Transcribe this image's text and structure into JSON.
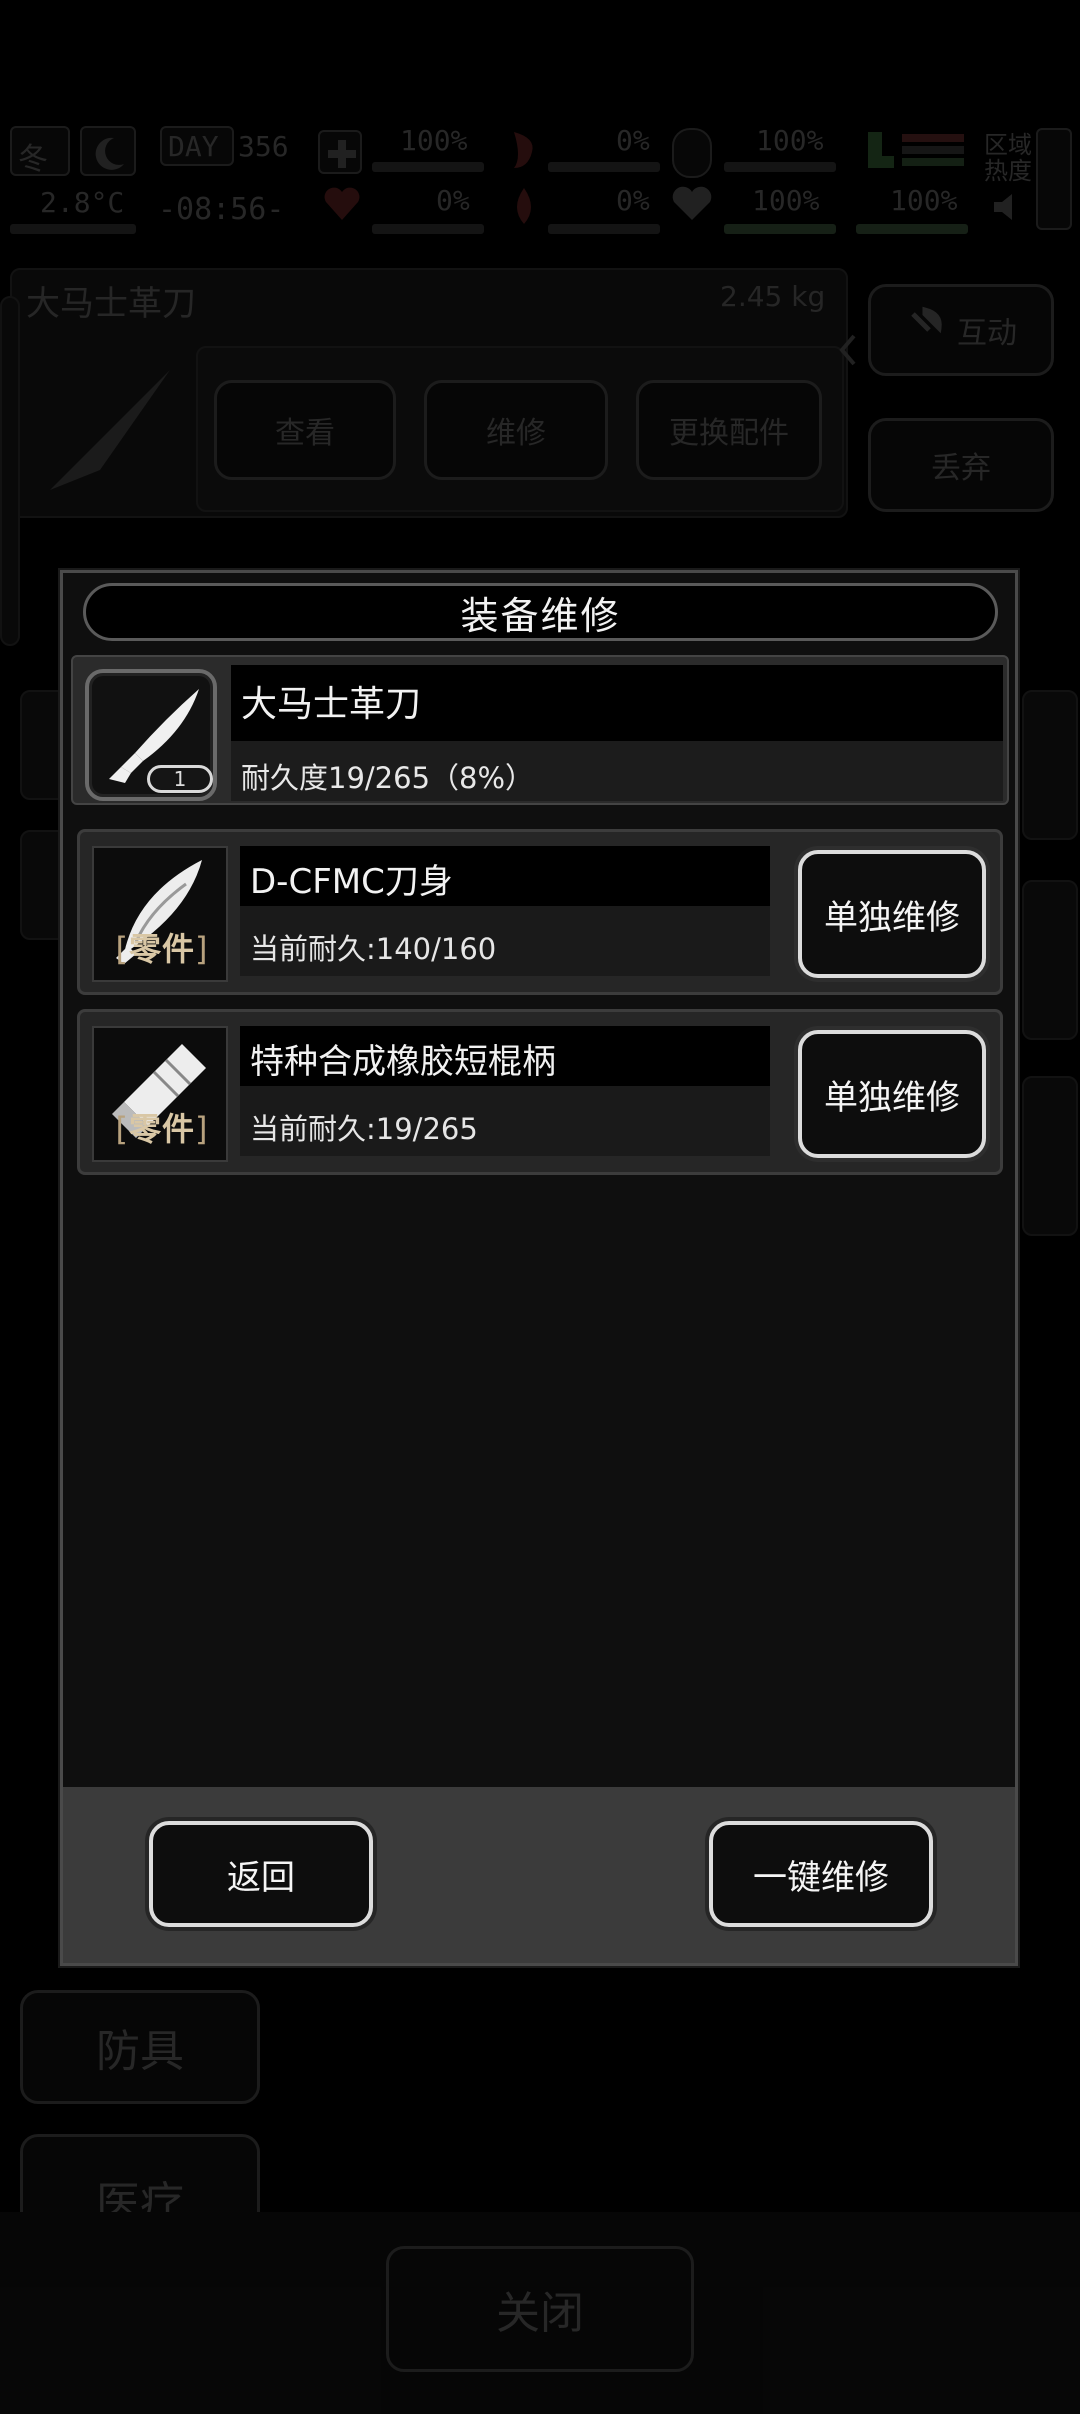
{
  "status": {
    "season": "冬",
    "day_label": "DAY",
    "day_number": "356",
    "temperature": "2.8°C",
    "time": "-08:56-",
    "health_pct": "100%",
    "thirst_pct": "0%",
    "bleed_pct": "0%",
    "injury_pct": "0%",
    "fullness_pct": "100%",
    "hydration_pct": "100%",
    "energy_pct": "100%",
    "region_heat_label": "区域\n热度"
  },
  "background": {
    "item_title": "大马士革刀",
    "item_weight": "2.45 kg",
    "buttons": {
      "view": "查看",
      "repair": "维修",
      "swap_parts": "更换配件"
    },
    "side_buttons": {
      "interact": "互动",
      "discard": "丢弃"
    },
    "categories": {
      "armor": "防具",
      "medical": "医疗"
    },
    "close_label": "关闭"
  },
  "modal": {
    "title": "装备维修",
    "item": {
      "name": "大马士革刀",
      "durability": "耐久度19/265（8%）",
      "count": "1"
    },
    "part_tag": "零件",
    "parts": [
      {
        "name": "D-CFMC刀身",
        "durability": "当前耐久:140/160",
        "button": "单独维修"
      },
      {
        "name": "特种合成橡胶短棍柄",
        "durability": "当前耐久:19/265",
        "button": "单独维修"
      }
    ],
    "footer": {
      "back": "返回",
      "repair_all": "一键维修"
    }
  }
}
